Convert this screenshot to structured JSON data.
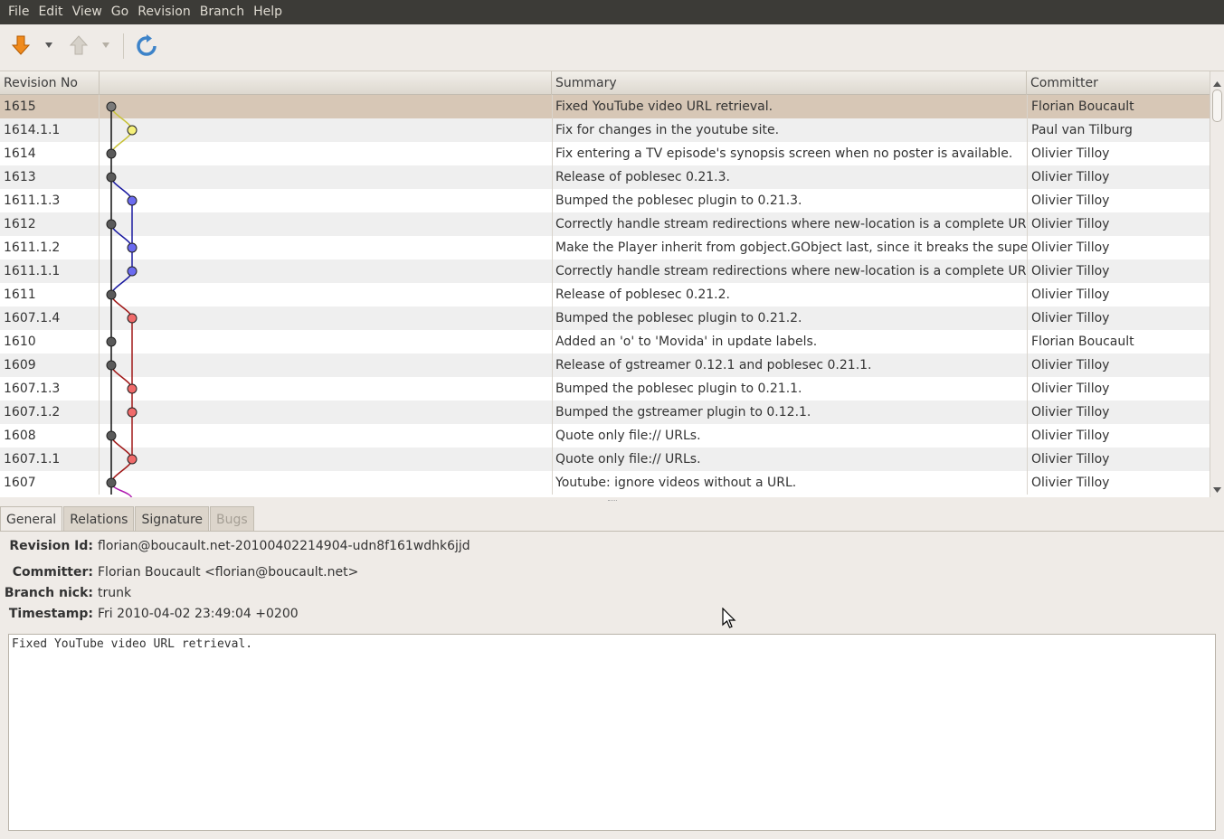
{
  "menu": [
    "File",
    "Edit",
    "View",
    "Go",
    "Revision",
    "Branch",
    "Help"
  ],
  "toolbar": {
    "icons": [
      "arrow-down-icon",
      "dropdown-arrow-icon",
      "arrow-up-icon",
      "dropdown-arrow-icon",
      "refresh-icon"
    ]
  },
  "columns": {
    "revno": "Revision No",
    "summary": "Summary",
    "committer": "Committer"
  },
  "rows": [
    {
      "revno": "1615",
      "summary": "Fixed YouTube video URL retrieval.",
      "committer": "Florian Boucault"
    },
    {
      "revno": "1614.1.1",
      "summary": "Fix for changes in the youtube site.",
      "committer": "Paul van Tilburg"
    },
    {
      "revno": "1614",
      "summary": "Fix entering a TV episode's synopsis screen when no poster is available.",
      "committer": "Olivier Tilloy"
    },
    {
      "revno": "1613",
      "summary": "Release of poblesec 0.21.3.",
      "committer": "Olivier Tilloy"
    },
    {
      "revno": "1611.1.3",
      "summary": "Bumped the poblesec plugin to 0.21.3.",
      "committer": "Olivier Tilloy"
    },
    {
      "revno": "1612",
      "summary": "Correctly handle stream redirections where new-location is a complete URI.",
      "committer": "Olivier Tilloy"
    },
    {
      "revno": "1611.1.2",
      "summary": "Make the Player inherit from gobject.GObject last, since it breaks the super() ...",
      "committer": "Olivier Tilloy"
    },
    {
      "revno": "1611.1.1",
      "summary": "Correctly handle stream redirections where new-location is a complete URI.",
      "committer": "Olivier Tilloy"
    },
    {
      "revno": "1611",
      "summary": "Release of poblesec 0.21.2.",
      "committer": "Olivier Tilloy"
    },
    {
      "revno": "1607.1.4",
      "summary": "Bumped the poblesec plugin to 0.21.2.",
      "committer": "Olivier Tilloy"
    },
    {
      "revno": "1610",
      "summary": "Added an 'o' to 'Movida' in update labels.",
      "committer": "Florian Boucault"
    },
    {
      "revno": "1609",
      "summary": "Release of gstreamer 0.12.1 and poblesec 0.21.1.",
      "committer": "Olivier Tilloy"
    },
    {
      "revno": "1607.1.3",
      "summary": "Bumped the poblesec plugin to 0.21.1.",
      "committer": "Olivier Tilloy"
    },
    {
      "revno": "1607.1.2",
      "summary": "Bumped the gstreamer plugin to 0.12.1.",
      "committer": "Olivier Tilloy"
    },
    {
      "revno": "1608",
      "summary": "Quote only file:// URLs.",
      "committer": "Olivier Tilloy"
    },
    {
      "revno": "1607.1.1",
      "summary": "Quote only file:// URLs.",
      "committer": "Olivier Tilloy"
    },
    {
      "revno": "1607",
      "summary": "Youtube: ignore videos without a URL.",
      "committer": "Olivier Tilloy"
    }
  ],
  "graph_nodes": [
    {
      "lane": 0,
      "color": "#7a7a7a"
    },
    {
      "lane": 1,
      "color": "#f5f07a"
    },
    {
      "lane": 0,
      "color": "#5a5a5a"
    },
    {
      "lane": 0,
      "color": "#5a5a5a"
    },
    {
      "lane": 1,
      "color": "#6b6bf0"
    },
    {
      "lane": 0,
      "color": "#5a5a5a"
    },
    {
      "lane": 1,
      "color": "#6b6bf0"
    },
    {
      "lane": 1,
      "color": "#6b6bf0"
    },
    {
      "lane": 0,
      "color": "#5a5a5a"
    },
    {
      "lane": 1,
      "color": "#f06b6b"
    },
    {
      "lane": 0,
      "color": "#5a5a5a"
    },
    {
      "lane": 0,
      "color": "#5a5a5a"
    },
    {
      "lane": 1,
      "color": "#f06b6b"
    },
    {
      "lane": 1,
      "color": "#f06b6b"
    },
    {
      "lane": 0,
      "color": "#5a5a5a"
    },
    {
      "lane": 1,
      "color": "#f06b6b"
    },
    {
      "lane": 0,
      "color": "#5a5a5a"
    }
  ],
  "tabs": [
    "General",
    "Relations",
    "Signature",
    "Bugs"
  ],
  "details": {
    "revision_id_label": "Revision Id:",
    "revision_id": "florian@boucault.net-20100402214904-udn8f161wdhk6jjd",
    "committer_label": "Committer:",
    "committer": "Florian Boucault <florian@boucault.net>",
    "branch_nick_label": "Branch nick:",
    "branch_nick": "trunk",
    "timestamp_label": "Timestamp:",
    "timestamp": "Fri 2010-04-02 23:49:04 +0200",
    "message": "Fixed YouTube video URL retrieval."
  }
}
